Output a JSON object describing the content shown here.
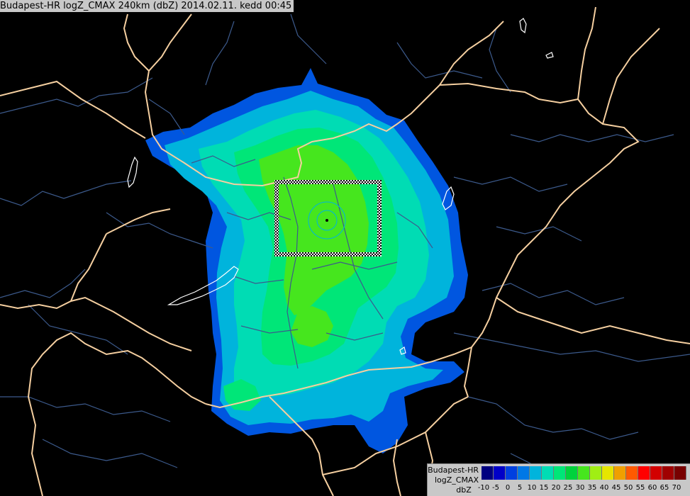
{
  "title": "Budapest-HR logZ_CMAX 240km (dbZ) 2014.02.11. kedd 00:45",
  "legend": {
    "line1": "Budapest-HR",
    "line2": "logZ_CMAX",
    "line3": "dbZ",
    "levels": [
      {
        "label": "-10",
        "color": "#000080"
      },
      {
        "label": "-5",
        "color": "#0000c8"
      },
      {
        "label": "0",
        "color": "#0040e0"
      },
      {
        "label": "5",
        "color": "#0078e6"
      },
      {
        "label": "10",
        "color": "#00b4dc"
      },
      {
        "label": "15",
        "color": "#00dcb4"
      },
      {
        "label": "20",
        "color": "#00e678"
      },
      {
        "label": "25",
        "color": "#00d23c"
      },
      {
        "label": "30",
        "color": "#46e61e"
      },
      {
        "label": "35",
        "color": "#a0ee14"
      },
      {
        "label": "40",
        "color": "#e6e600"
      },
      {
        "label": "45",
        "color": "#f0a000"
      },
      {
        "label": "50",
        "color": "#ff5a00"
      },
      {
        "label": "55",
        "color": "#ff0000"
      },
      {
        "label": "60",
        "color": "#d20000"
      },
      {
        "label": "65",
        "color": "#a00000"
      },
      {
        "label": "70",
        "color": "#780000"
      }
    ]
  },
  "colors": {
    "background": "#000000",
    "border_international": "#f5cfa0",
    "border_regional": "#3c5a8c",
    "lake": "#ffffff",
    "composite_box": "#ffffff"
  }
}
